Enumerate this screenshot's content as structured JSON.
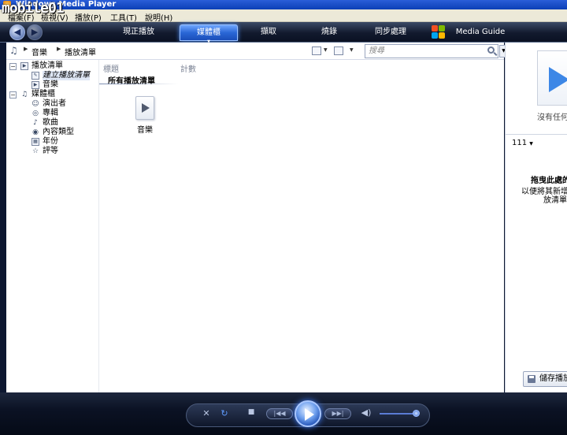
{
  "window": {
    "title": "Windows Media Player",
    "watermark": "mobile01"
  },
  "menu": {
    "items": [
      {
        "label": "檔案(F)"
      },
      {
        "label": "檢視(V)"
      },
      {
        "label": "播放(P)"
      },
      {
        "label": "工具(T)"
      },
      {
        "label": "說明(H)"
      }
    ]
  },
  "nav": {
    "tabs": [
      {
        "label": "現正播放",
        "active": false
      },
      {
        "label": "媒體櫃",
        "active": true
      },
      {
        "label": "擷取",
        "active": false
      },
      {
        "label": "燒錄",
        "active": false
      },
      {
        "label": "同步處理",
        "active": false
      },
      {
        "label": "Media Guide",
        "active": false
      }
    ]
  },
  "address": {
    "crumbs": [
      "音樂",
      "播放清單"
    ],
    "search_placeholder": "搜尋"
  },
  "tree": {
    "items": [
      {
        "label": "播放清單",
        "icon": "playlist-icon",
        "expander": "−"
      },
      {
        "label": "建立播放清單",
        "icon": "create-playlist-icon",
        "style": "italic"
      },
      {
        "label": "音樂",
        "icon": "playlist-icon"
      },
      {
        "label": "媒體櫃",
        "icon": "music-note-icon",
        "expander": "−"
      },
      {
        "label": "演出者",
        "icon": "artist-icon"
      },
      {
        "label": "專輯",
        "icon": "album-icon"
      },
      {
        "label": "歌曲",
        "icon": "song-icon"
      },
      {
        "label": "內容類型",
        "icon": "genre-icon"
      },
      {
        "label": "年份",
        "icon": "year-icon"
      },
      {
        "label": "評等",
        "icon": "rating-star-icon"
      }
    ]
  },
  "content": {
    "columns": [
      "標題",
      "計數"
    ],
    "group_title": "所有播放清單",
    "tiles": [
      {
        "label": "音樂",
        "icon": "playlist-play-icon"
      }
    ]
  },
  "rightpane": {
    "nothing_text": "沒有任何項",
    "list_name": "111",
    "drag_title": "拖曳此處的",
    "drag_line2": "以便將其新增到",
    "drag_line3": "放清單",
    "save_label": "儲存播放"
  },
  "colors": {
    "accent": "#2a67d6",
    "nav_bg": "#121a2e",
    "pane_bg": "#ffffff"
  }
}
